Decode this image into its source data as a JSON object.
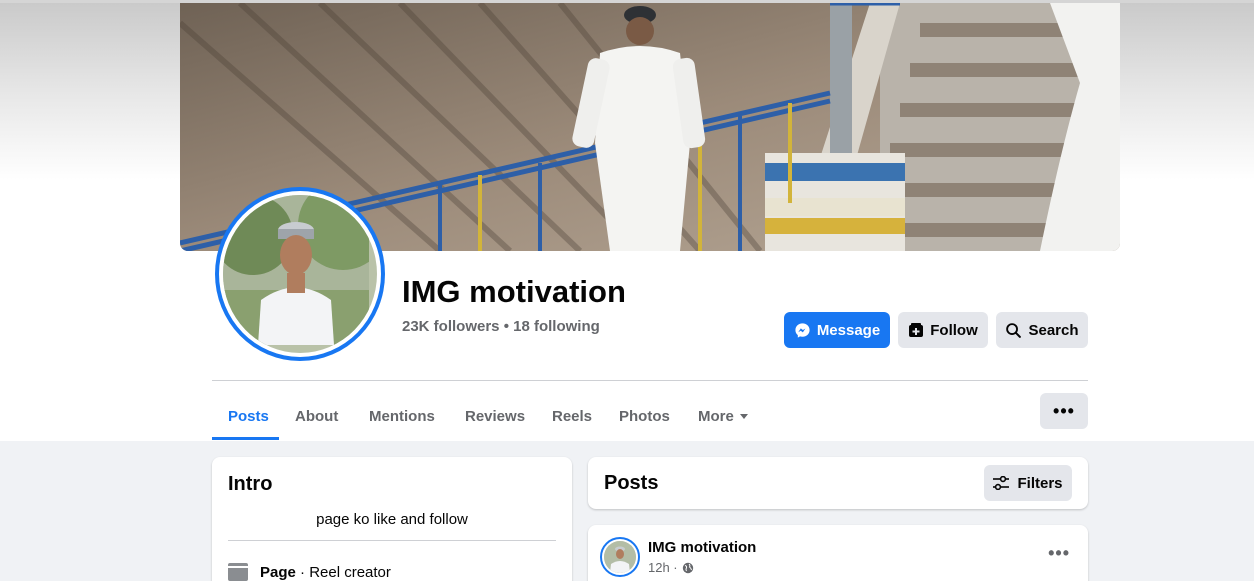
{
  "page": {
    "name": "IMG motivation",
    "followers_line": "23K followers • 18 following"
  },
  "actions": {
    "message_label": "Message",
    "follow_label": "Follow",
    "search_label": "Search"
  },
  "tabs": [
    {
      "label": "Posts",
      "active": true
    },
    {
      "label": "About"
    },
    {
      "label": "Mentions"
    },
    {
      "label": "Reviews"
    },
    {
      "label": "Reels"
    },
    {
      "label": "Photos"
    },
    {
      "label": "More"
    }
  ],
  "more_options_label": "•••",
  "intro": {
    "title": "Intro",
    "bio": "page ko like and follow",
    "category_label": "Page",
    "category_value": " · Reel creator"
  },
  "posts": {
    "title": "Posts",
    "filters_label": "Filters"
  },
  "post": {
    "author": "IMG motivation",
    "time": "12h ·",
    "more_label": "•••"
  },
  "colors": {
    "accent": "#1877f2",
    "secondary_button": "#e4e6eb",
    "background": "#f0f2f5",
    "muted_text": "#65676b"
  },
  "icons": {
    "message": "messenger-icon",
    "follow": "follow-icon",
    "search": "search-icon",
    "filters": "filters-icon",
    "category": "page-category-icon",
    "privacy": "globe-icon"
  }
}
